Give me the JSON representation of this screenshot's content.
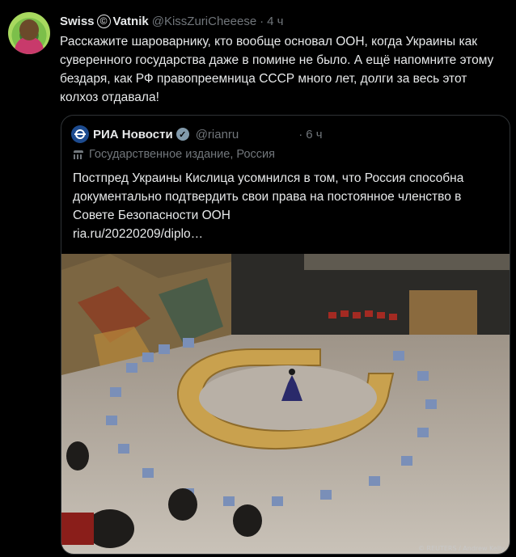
{
  "tweet": {
    "author_name": "Swiss",
    "author_name_symbol": "©",
    "author_name_suffix": "Vatnik",
    "handle": "@KissZuriCheeese",
    "separator": "·",
    "time": "4 ч",
    "text": "Расскажите шароварнику, кто вообще основал ООН, когда Украины как суверенного государства даже в помине не было. А ещё напомните этому бездаря, как РФ правопреемница СССР много лет, долги за весь этот колхоз отдавала!"
  },
  "quoted": {
    "author_name": "РИА Новости",
    "handle": "@rianru",
    "separator": "·",
    "time": "6 ч",
    "label": "Государственное издание, Россия",
    "text": "Постпред Украины Кислица усомнился в том, что Россия способна документально подтвердить свои права на постоянное членство в Совете Безопасности ООН",
    "link": "ria.ru/20220209/diplo…",
    "photo_credit": "© REUTERS / Andrew Kelly"
  },
  "colors": {
    "background": "#000000",
    "text_primary": "#e7e9ea",
    "text_secondary": "#71767b",
    "border": "#2f3336",
    "verified_badge": "#829aab"
  },
  "icons": [
    "avatar",
    "copyright-icon",
    "ria-logo",
    "verified-badge-icon",
    "government-building-icon"
  ]
}
